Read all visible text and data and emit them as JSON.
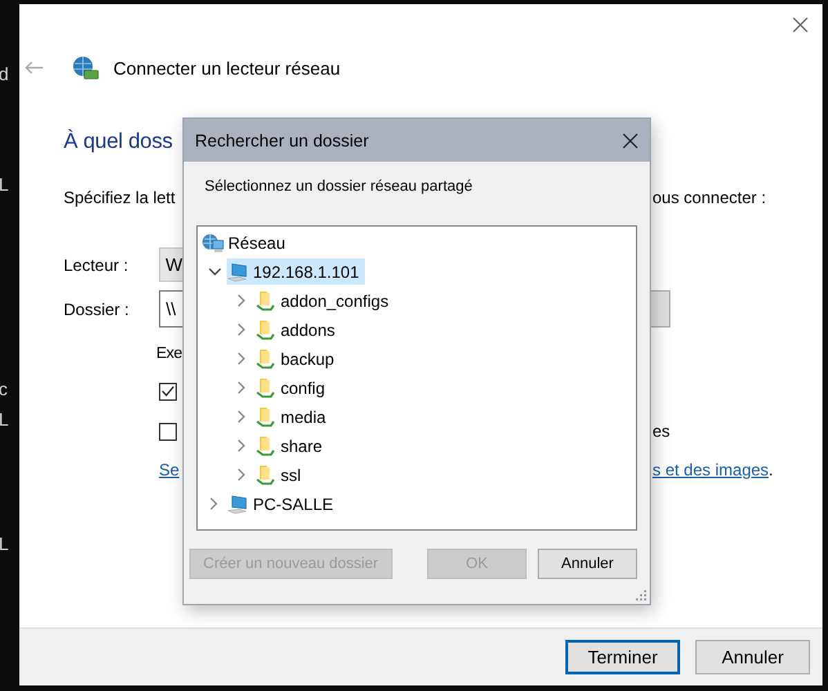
{
  "background_fragments": [
    "d",
    "L",
    "c",
    "L",
    "L"
  ],
  "window": {
    "title": "Connecter un lecteur réseau",
    "heading": "À quel doss",
    "instruction": "Spécifiez la lett",
    "instruction_end": "ous connecter :",
    "drive": {
      "label": "Lecteur :",
      "value": "W"
    },
    "folder": {
      "label": "Dossier :",
      "value": "\\\\"
    },
    "options_label": "Exe",
    "checkboxes": [
      {
        "checked": true
      },
      {
        "checked": false,
        "label_end": "es"
      }
    ],
    "link": {
      "start": "Se",
      "end": "s et des images",
      "after": "."
    },
    "buttons": [
      {
        "label": "Terminer",
        "default": true
      },
      {
        "label": "Annuler",
        "default": false
      }
    ]
  },
  "dialog": {
    "title": "Rechercher un dossier",
    "prompt": "Sélectionnez un dossier réseau partagé",
    "tree": [
      {
        "label": "Réseau",
        "kind": "network",
        "selected": false,
        "children": [
          {
            "label": "192.168.1.101",
            "kind": "computer",
            "selected": true,
            "expanded": true,
            "children": [
              {
                "label": "addon_configs",
                "kind": "folder",
                "selected": false,
                "expanded": false
              },
              {
                "label": "addons",
                "kind": "folder",
                "selected": false,
                "expanded": false
              },
              {
                "label": "backup",
                "kind": "folder",
                "selected": false,
                "expanded": false
              },
              {
                "label": "config",
                "kind": "folder",
                "selected": false,
                "expanded": false
              },
              {
                "label": "media",
                "kind": "folder",
                "selected": false,
                "expanded": false
              },
              {
                "label": "share",
                "kind": "folder",
                "selected": false,
                "expanded": false
              },
              {
                "label": "ssl",
                "kind": "folder",
                "selected": false,
                "expanded": false
              }
            ]
          },
          {
            "label": "PC-SALLE",
            "kind": "computer",
            "selected": false,
            "expanded": false
          }
        ]
      }
    ],
    "buttons": [
      {
        "label": "Créer un nouveau dossier",
        "disabled": true
      },
      {
        "label": "OK",
        "disabled": true
      },
      {
        "label": "Annuler",
        "disabled": false
      }
    ]
  }
}
